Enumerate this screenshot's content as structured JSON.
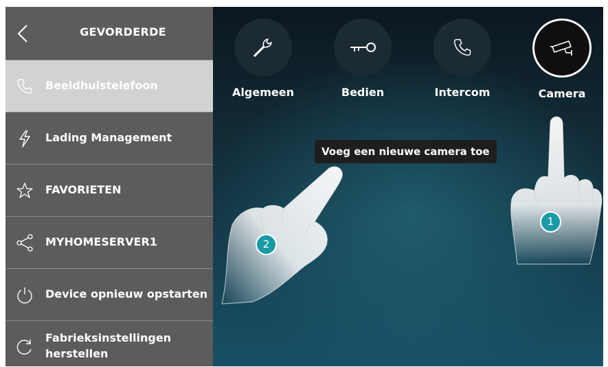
{
  "sidebar": {
    "title": "GEVORDERDE",
    "items": [
      {
        "label": "Beeldhuistelefoon",
        "icon": "phone-icon",
        "active": true
      },
      {
        "label": "Lading Management",
        "icon": "lightning-icon",
        "active": false
      },
      {
        "label": "FAVORIETEN",
        "icon": "star-icon",
        "active": false
      },
      {
        "label": "MYHOMESERVER1",
        "icon": "share-icon",
        "active": false
      },
      {
        "label": "Device opnieuw opstarten",
        "icon": "power-icon",
        "active": false
      },
      {
        "label": "Fabrieksinstellingen herstellen",
        "icon": "reset-icon",
        "active": false
      }
    ]
  },
  "functions": [
    {
      "label": "Algemeen",
      "icon": "wrench-icon"
    },
    {
      "label": "Bedien",
      "icon": "key-icon"
    },
    {
      "label": "Intercom",
      "icon": "phone-icon"
    },
    {
      "label": "Camera",
      "icon": "camera-icon",
      "selected": true
    }
  ],
  "tooltip": "Voeg een nieuwe camera toe",
  "steps": {
    "step1": "1",
    "step2": "2"
  },
  "colors": {
    "sidebar": "#5c5c5c",
    "active_item": "#d2d2d2",
    "badge": "#1a9aa5",
    "tooltip_bg": "#1e1e1e"
  }
}
